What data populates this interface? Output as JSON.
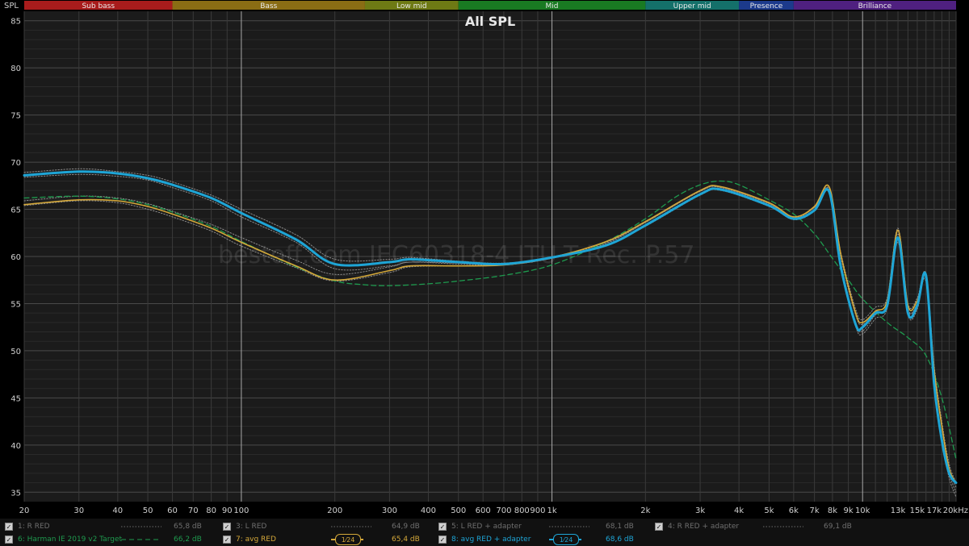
{
  "chart_data": {
    "type": "line",
    "title": "All SPL",
    "ylabel": "SPL",
    "xlabel": "",
    "x_scale": "log",
    "xlim": [
      20,
      20000
    ],
    "ylim": [
      34,
      86
    ],
    "watermark": "bestoff.com IEC60318-4 ITU-T Rec. P.57",
    "y_ticks": [
      35,
      40,
      45,
      50,
      55,
      60,
      65,
      70,
      75,
      80,
      85
    ],
    "x_ticks": [
      {
        "v": 20,
        "l": "20"
      },
      {
        "v": 30,
        "l": "30"
      },
      {
        "v": 40,
        "l": "40"
      },
      {
        "v": 50,
        "l": "50"
      },
      {
        "v": 60,
        "l": "60"
      },
      {
        "v": 70,
        "l": "70"
      },
      {
        "v": 80,
        "l": "80"
      },
      {
        "v": 90,
        "l": "90"
      },
      {
        "v": 100,
        "l": "100"
      },
      {
        "v": 200,
        "l": "200"
      },
      {
        "v": 300,
        "l": "300"
      },
      {
        "v": 400,
        "l": "400"
      },
      {
        "v": 500,
        "l": "500"
      },
      {
        "v": 600,
        "l": "600"
      },
      {
        "v": 700,
        "l": "700"
      },
      {
        "v": 800,
        "l": "800"
      },
      {
        "v": 900,
        "l": "900"
      },
      {
        "v": 1000,
        "l": "1k"
      },
      {
        "v": 2000,
        "l": "2k"
      },
      {
        "v": 3000,
        "l": "3k"
      },
      {
        "v": 4000,
        "l": "4k"
      },
      {
        "v": 5000,
        "l": "5k"
      },
      {
        "v": 6000,
        "l": "6k"
      },
      {
        "v": 7000,
        "l": "7k"
      },
      {
        "v": 8000,
        "l": "8k"
      },
      {
        "v": 9000,
        "l": "9k"
      },
      {
        "v": 10000,
        "l": "10k"
      },
      {
        "v": 13000,
        "l": "13k"
      },
      {
        "v": 15000,
        "l": "15k"
      },
      {
        "v": 17000,
        "l": "17k"
      },
      {
        "v": 20000,
        "l": "20kHz"
      }
    ],
    "bands": [
      {
        "name": "Sub bass",
        "from": 20,
        "to": 60,
        "color": "#a81c1c"
      },
      {
        "name": "Bass",
        "from": 60,
        "to": 250,
        "color": "#8a6d14"
      },
      {
        "name": "Low mid",
        "from": 250,
        "to": 500,
        "color": "#6e7a14"
      },
      {
        "name": "Mid",
        "from": 500,
        "to": 2000,
        "color": "#197a22"
      },
      {
        "name": "Upper mid",
        "from": 2000,
        "to": 4000,
        "color": "#14706a"
      },
      {
        "name": "Presence",
        "from": 4000,
        "to": 6000,
        "color": "#1c3a8c"
      },
      {
        "name": "Brilliance",
        "from": 6000,
        "to": 20000,
        "color": "#4f2080"
      }
    ],
    "series": [
      {
        "name": "1: R RED",
        "color": "#8a8a8a",
        "style": "dotted",
        "width": 1,
        "x": [
          20,
          30,
          40,
          50,
          60,
          80,
          100,
          150,
          200,
          300,
          350,
          500,
          700,
          1000,
          1500,
          2000,
          3000,
          3500,
          5000,
          6000,
          7000,
          7800,
          8500,
          9500,
          10000,
          11000,
          12000,
          13000,
          14000,
          15000,
          16000,
          17000,
          18000,
          19000,
          20000
        ],
        "y": [
          65.4,
          65.9,
          65.7,
          65.0,
          64.2,
          62.7,
          61.1,
          58.8,
          57.4,
          58.3,
          58.9,
          59.0,
          59.1,
          59.9,
          61.5,
          63.6,
          66.9,
          67.3,
          65.6,
          64.1,
          65.2,
          67.1,
          60.0,
          53.8,
          52.8,
          54.0,
          55.0,
          62.4,
          54.5,
          55.0,
          57.6,
          48.0,
          42.0,
          37.5,
          35.5
        ]
      },
      {
        "name": "3: L RED",
        "color": "#8a8a8a",
        "style": "dotted",
        "width": 1,
        "x": [
          20,
          30,
          40,
          50,
          60,
          80,
          100,
          150,
          200,
          300,
          350,
          500,
          700,
          1000,
          1500,
          2000,
          3000,
          3500,
          5000,
          6000,
          7000,
          7800,
          8500,
          9500,
          10000,
          11000,
          12000,
          13000,
          14000,
          15000,
          16000,
          17000,
          18000,
          19000,
          20000
        ],
        "y": [
          65.9,
          66.4,
          66.2,
          65.6,
          64.8,
          63.4,
          62.0,
          59.6,
          58.1,
          58.9,
          59.4,
          59.2,
          59.1,
          59.8,
          61.4,
          63.6,
          66.9,
          67.3,
          65.6,
          64.2,
          65.2,
          67.2,
          60.5,
          54.4,
          53.3,
          54.6,
          55.6,
          63.0,
          55.0,
          55.6,
          58.2,
          48.5,
          42.5,
          38.0,
          36.0
        ]
      },
      {
        "name": "5: L RED + adapter",
        "color": "#8a8a8a",
        "style": "dotted",
        "width": 1,
        "x": [
          20,
          30,
          40,
          50,
          60,
          80,
          100,
          150,
          200,
          300,
          350,
          500,
          700,
          1000,
          1500,
          2000,
          3000,
          3500,
          5000,
          6000,
          7000,
          7800,
          8500,
          9500,
          10000,
          11000,
          12000,
          13000,
          14000,
          15000,
          16000,
          17000,
          18000,
          19000,
          20000
        ],
        "y": [
          68.9,
          69.3,
          69.0,
          68.6,
          67.9,
          66.5,
          65.0,
          62.3,
          59.7,
          59.7,
          59.9,
          59.5,
          59.3,
          59.9,
          61.3,
          63.3,
          66.6,
          67.1,
          65.4,
          64.0,
          64.9,
          66.9,
          59.2,
          52.9,
          52.1,
          53.8,
          54.9,
          61.5,
          54.3,
          55.0,
          57.3,
          46.5,
          41.0,
          37.0,
          35.0
        ]
      },
      {
        "name": "4: R RED + adapter",
        "color": "#8a8a8a",
        "style": "dotted",
        "width": 1,
        "x": [
          20,
          30,
          40,
          50,
          60,
          80,
          100,
          150,
          200,
          300,
          350,
          500,
          700,
          1000,
          1500,
          2000,
          3000,
          3500,
          5000,
          6000,
          7000,
          7800,
          8500,
          9500,
          10000,
          11000,
          12000,
          13000,
          14000,
          15000,
          16000,
          17000,
          18000,
          19000,
          20000
        ],
        "y": [
          68.4,
          68.7,
          68.5,
          68.1,
          67.3,
          65.9,
          64.2,
          61.5,
          58.7,
          59.0,
          59.4,
          59.3,
          59.1,
          59.8,
          61.2,
          63.2,
          66.5,
          67.0,
          65.3,
          63.9,
          64.8,
          66.8,
          59.0,
          52.6,
          51.8,
          53.4,
          54.5,
          61.8,
          53.8,
          54.4,
          57.9,
          47.0,
          40.5,
          36.5,
          34.5
        ]
      },
      {
        "name": "6: Harman IE 2019 v2 Target",
        "color": "#1e9a4e",
        "style": "dashed",
        "width": 1.3,
        "x": [
          20,
          30,
          40,
          50,
          60,
          80,
          100,
          150,
          200,
          250,
          300,
          400,
          500,
          700,
          1000,
          1500,
          2000,
          2500,
          3000,
          3500,
          4000,
          5000,
          6000,
          7000,
          8000,
          9000,
          10000,
          12000,
          14000,
          16000,
          18000,
          20000
        ],
        "y": [
          66.2,
          66.4,
          66.1,
          65.5,
          64.7,
          63.2,
          61.6,
          58.9,
          57.4,
          57.0,
          56.9,
          57.1,
          57.4,
          58.0,
          59.1,
          61.6,
          64.0,
          66.3,
          67.6,
          68.0,
          67.6,
          66.0,
          64.5,
          62.4,
          59.8,
          57.5,
          55.5,
          53.0,
          51.4,
          49.5,
          45.0,
          38.5
        ]
      },
      {
        "name": "7: avg RED",
        "color": "#d4a83a",
        "style": "solid",
        "width": 1.6,
        "x": [
          20,
          30,
          40,
          50,
          60,
          80,
          100,
          150,
          200,
          300,
          350,
          500,
          700,
          1000,
          1500,
          2000,
          3000,
          3500,
          5000,
          6000,
          7000,
          7800,
          8500,
          9500,
          10000,
          11000,
          12000,
          13000,
          14000,
          15000,
          16000,
          17000,
          18000,
          19000,
          20000
        ],
        "y": [
          65.5,
          66.0,
          65.9,
          65.3,
          64.5,
          63.0,
          61.5,
          59.0,
          57.5,
          58.5,
          59.0,
          59.0,
          59.1,
          59.9,
          61.6,
          63.7,
          67.0,
          67.4,
          65.7,
          64.2,
          65.3,
          67.4,
          60.3,
          54.0,
          53.0,
          54.2,
          55.3,
          62.8,
          54.8,
          55.3,
          57.8,
          48.0,
          42.0,
          37.5,
          36.0
        ]
      },
      {
        "name": "8: avg RED + adapter",
        "color": "#1ea5d6",
        "style": "solid",
        "width": 3,
        "x": [
          20,
          30,
          40,
          50,
          60,
          80,
          100,
          150,
          200,
          300,
          350,
          500,
          700,
          1000,
          1500,
          2000,
          3000,
          3500,
          5000,
          6000,
          7000,
          7800,
          8500,
          9500,
          10000,
          11000,
          12000,
          13000,
          14000,
          15000,
          16000,
          17000,
          18000,
          19000,
          20000
        ],
        "y": [
          68.6,
          69.0,
          68.8,
          68.3,
          67.6,
          66.2,
          64.6,
          61.8,
          59.2,
          59.4,
          59.7,
          59.4,
          59.2,
          59.9,
          61.2,
          63.3,
          66.6,
          67.1,
          65.4,
          64.0,
          64.9,
          66.9,
          59.0,
          52.8,
          52.5,
          54.0,
          54.8,
          62.0,
          54.0,
          54.8,
          58.0,
          46.5,
          40.5,
          37.0,
          36.0
        ]
      }
    ],
    "legend": [
      {
        "check": "✓",
        "name": "1: R RED",
        "value": "65,8 dB",
        "color": "#8a8a8a",
        "dim": true
      },
      {
        "check": "✓",
        "name": "3: L RED",
        "value": "64,9 dB",
        "color": "#8a8a8a",
        "dim": true
      },
      {
        "check": "✓",
        "name": "5: L RED + adapter",
        "value": "68,1 dB",
        "color": "#8a8a8a",
        "dim": true
      },
      {
        "check": "✓",
        "name": "4: R RED + adapter",
        "value": "69,1 dB",
        "color": "#8a8a8a",
        "dim": true
      },
      {
        "check": "✓",
        "name": "6: Harman IE 2019 v2 Target",
        "value": "66,2 dB",
        "color": "#1e9a4e",
        "dim": false
      },
      {
        "check": "✓",
        "name": "7: avg RED",
        "value": "65,4 dB",
        "color": "#d4a83a",
        "dim": false,
        "smoothing": "1⁄24"
      },
      {
        "check": "✓",
        "name": "8: avg RED + adapter",
        "value": "68,6 dB",
        "color": "#1ea5d6",
        "dim": false,
        "smoothing": "1⁄24"
      }
    ]
  }
}
